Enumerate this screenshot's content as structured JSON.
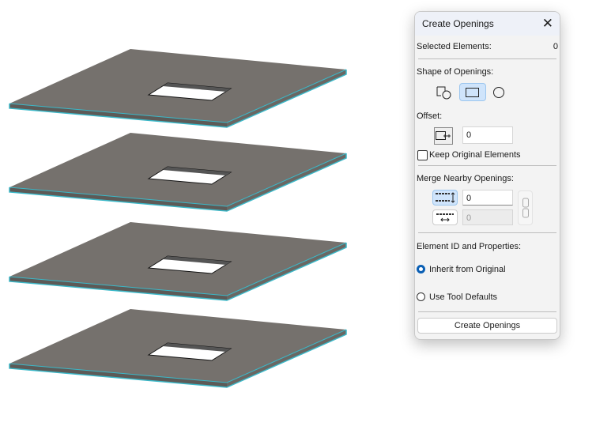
{
  "panel": {
    "title": "Create Openings",
    "selected_label": "Selected Elements:",
    "selected_count": "0",
    "shape_label": "Shape of Openings:",
    "shapes": [
      {
        "name": "custom-shape"
      },
      {
        "name": "rectangle",
        "selected": true
      },
      {
        "name": "circle"
      }
    ],
    "offset_label": "Offset:",
    "offset_value": "0",
    "keep_original_label": "Keep Original Elements",
    "keep_original_checked": false,
    "merge_label": "Merge Nearby Openings:",
    "merge_vertical_value": "0",
    "merge_horizontal_value": "0",
    "element_id_label": "Element ID and Properties:",
    "inherit_label": "Inherit from Original",
    "tool_defaults_label": "Use Tool Defaults",
    "selected_option": "inherit",
    "create_button": "Create Openings"
  },
  "colors": {
    "slab": "#6f6b67",
    "edge": "#3bb8c8",
    "accent": "#0a5fb4"
  }
}
